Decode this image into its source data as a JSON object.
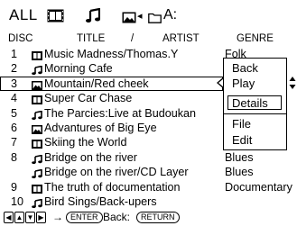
{
  "modebar": {
    "all_label": "ALL",
    "video_icon": "film-icon",
    "music_icon": "music-note-icon",
    "photo_icon": "photo-icon",
    "arrow_glyph": "◂",
    "folder_icon": "folder-icon",
    "path": "A:"
  },
  "header": {
    "disc": "DISC",
    "title": "TITLE",
    "slash": "/",
    "artist": "ARTIST",
    "genre": "GENRE"
  },
  "rows": [
    {
      "num": "1",
      "icon": "film-icon",
      "title": "Music Madness/Thomas.Y",
      "genre": "Folk"
    },
    {
      "num": "2",
      "icon": "music-note-icon",
      "title": "Morning Cafe",
      "genre": ""
    },
    {
      "num": "3",
      "icon": "photo-icon",
      "title": "Mountain/Red cheek",
      "genre": ""
    },
    {
      "num": "4",
      "icon": "film-icon",
      "title": "Super Car Chase",
      "genre": ""
    },
    {
      "num": "5",
      "icon": "music-note-icon",
      "title": "The Parcies:Live at Budoukan",
      "genre": ""
    },
    {
      "num": "6",
      "icon": "photo-icon",
      "title": "Advantures of Big Eye",
      "genre": ""
    },
    {
      "num": "7",
      "icon": "film-icon",
      "title": "Skiing the World",
      "genre": ""
    },
    {
      "num": "8",
      "icon": "music-note-icon",
      "title": "Bridge on the river",
      "genre": "Blues"
    },
    {
      "num": "",
      "icon": "music-note-icon",
      "title": "Bridge on the river/CD Layer",
      "genre": "Blues"
    },
    {
      "num": "9",
      "icon": "film-icon",
      "title": "The truth of documentation",
      "genre": "Documentary"
    },
    {
      "num": "10",
      "icon": "music-note-icon",
      "title": "Bird Sings/Back-upers",
      "genre": ""
    }
  ],
  "selected_row": 2,
  "popup": {
    "items": [
      "Back",
      "Play",
      "Details",
      "File",
      "Edit"
    ],
    "highlighted": "Details"
  },
  "updown_glyph": "▲▼",
  "bottombar": {
    "keys": [
      "◀",
      "▲",
      "▼",
      "▶"
    ],
    "arrow": "→",
    "enter": "ENTER",
    "back_label": "Back:",
    "return": "RETURN"
  }
}
